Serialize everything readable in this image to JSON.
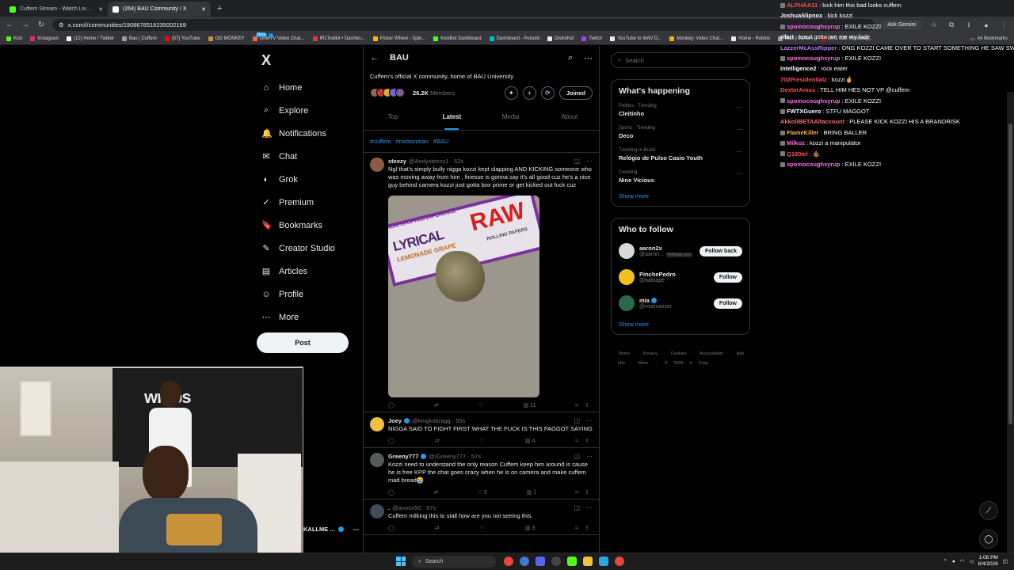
{
  "browser": {
    "tabs": [
      {
        "title": "Cuffem Stream - Watch Live on",
        "favicon_color": "#53fc18",
        "active": false
      },
      {
        "title": "(264) BAU Community / X",
        "favicon_color": "#ffffff",
        "active": true
      }
    ],
    "new_tab": "+",
    "url": "x.com/i/communities/1908678516235002169",
    "ask_gemini": "Ask Gemini",
    "bookmarks": [
      {
        "label": "Kick",
        "color": "#53fc18"
      },
      {
        "label": "Instagram",
        "color": "#e1306c"
      },
      {
        "label": "(12) Home / Twitter",
        "color": "#ffffff"
      },
      {
        "label": "Bau | Cuffem",
        "color": "#9aa0a6"
      },
      {
        "label": "(57) YouTube",
        "color": "#ff0000"
      },
      {
        "label": "OG MONKEY",
        "color": "#c58f3d"
      },
      {
        "label": "OmeTV Video Chat...",
        "color": "#f26b3a"
      },
      {
        "label": "IRLToolkit • Dashbo...",
        "color": "#e53935"
      },
      {
        "label": "Picker Wheel - Spin...",
        "color": "#fbbc05"
      },
      {
        "label": "KickBot Dashboard",
        "color": "#53fc18"
      },
      {
        "label": "Dashboard - Pulsoid",
        "color": "#00bcd4"
      },
      {
        "label": "DistroKid",
        "color": "#e8eaed"
      },
      {
        "label": "Twitch",
        "color": "#9146ff"
      },
      {
        "label": "YouTube to WAV D...",
        "color": "#e8eaed"
      },
      {
        "label": "Monkey: Video Chat...",
        "color": "#f5b400"
      },
      {
        "label": "Home - Roblox",
        "color": "#e8eaed"
      },
      {
        "label": "Bau | Cuffem",
        "color": "#9aa0a6"
      },
      {
        "label": "UFC 328: Holloway...",
        "color": "#d20a0a"
      }
    ],
    "all_bookmarks": "All Bookmarks"
  },
  "nav": {
    "logo": "X",
    "items": [
      {
        "label": "Home",
        "icon": "⌂"
      },
      {
        "label": "Explore",
        "icon": "⌕"
      },
      {
        "label": "Notifications",
        "icon": "🔔"
      },
      {
        "label": "Chat",
        "icon": "✉"
      },
      {
        "label": "Grok",
        "icon": "◐"
      },
      {
        "label": "Premium",
        "icon": "✓"
      },
      {
        "label": "Bookmarks",
        "icon": "🔖"
      },
      {
        "label": "Creator Studio",
        "icon": "✎"
      },
      {
        "label": "Articles",
        "icon": "▤"
      },
      {
        "label": "Profile",
        "icon": "☺"
      },
      {
        "label": "More",
        "icon": "⋯"
      }
    ],
    "chat_badge": "Beta",
    "post_button": "Post"
  },
  "community": {
    "back": "←",
    "title": "BAU",
    "description": "Cuffem's official X community, home of BAU University",
    "members_count": "26.2K",
    "members_label": "Members",
    "joined": "Joined",
    "tabs": [
      "Top",
      "Latest",
      "Media",
      "About"
    ],
    "active_tab": "Latest",
    "hashtags": [
      "#cuffem",
      "#motionman",
      "#BAU"
    ]
  },
  "posts": [
    {
      "name": "steezy",
      "handle": "@Andysteezy1 · 52s",
      "verified": false,
      "avatar_color": "#8a5a44",
      "text": "Ngl that's simply bully nigga kozzi kept slapping AND KICKING someone who was moving away from him , finesse is gonna say it's all good cuz he's a nice guy behind camera kozzi just gotta box prime or get kicked out fuck cuz",
      "views": "11",
      "has_image": true,
      "image": {
        "pack_top": "REAL UPLIFTING EXPERIENCE",
        "pack_brand": "LYRICAL",
        "pack_raw": "RAW",
        "pack_flavor": "LEMONADE GRAPE",
        "pack_sub": "ROLLING PAPERS"
      }
    },
    {
      "name": "Joey",
      "handle": "@kingkobragg · 55s",
      "verified": true,
      "avatar_color": "#f0c040",
      "text": "NIGGA SAID TO FIGHT FIRST WHAT THE FUCK IS THIS FAGGOT SAYING",
      "views": "4",
      "has_image": false
    },
    {
      "name": "Greeny777",
      "handle": "@IGreeny777 · 57s",
      "verified": true,
      "avatar_color": "#555b55",
      "text": "Kozzi need to understand the only reason Cuffem keep him around is cause he is free KPP the chat goes crazy when he is on camera and make cuffem mad bread😭",
      "likes": "5",
      "views": "1",
      "has_image": false
    },
    {
      "name": ".",
      "handle": "@anonx50 · 57s",
      "verified": false,
      "avatar_color": "#444a5a",
      "text": "Cuffem milking this to stall how are you not seeing this.",
      "views": "3",
      "has_image": false
    }
  ],
  "right": {
    "search_placeholder": "Search",
    "happening_title": "What's happening",
    "trends": [
      {
        "meta": "Politics · Trending",
        "name": "Cleitinho"
      },
      {
        "meta": "Sports · Trending",
        "name": "Deco"
      },
      {
        "meta": "Trending in Brazil",
        "name": "Relógio de Pulso Casio Youth"
      },
      {
        "meta": "Trending",
        "name": "Nine Vicious"
      }
    ],
    "show_more": "Show more",
    "wtf_title": "Who to follow",
    "follow": [
      {
        "name": "aaron2x",
        "handle": "@aaron...",
        "follows_you": "Follows you",
        "button": "Follow back",
        "color": "#d9d9d9",
        "verified": false
      },
      {
        "name": "PinchePedro",
        "handle": "@babiape",
        "follows_you": "",
        "button": "Follow",
        "color": "#f0c020",
        "verified": false
      },
      {
        "name": "mia",
        "handle": "@miamaxxer",
        "follows_you": "",
        "button": "Follow",
        "color": "#2a6a4a",
        "verified": true
      }
    ],
    "footer": "Terms · Privacy · Cookies · Accessibility · Ads info · More ··· © 2026 X Corp."
  },
  "chat_overlay": [
    {
      "user": "ALPHAA11",
      "text": "kick him this bad looks cuffem",
      "color": "#ff4d4d",
      "badge": true
    },
    {
      "user": "JoshuaSlipnox",
      "text": "kick kozzi",
      "color": "#ffffff",
      "badge": false
    },
    {
      "user": "spomocoughsyrup",
      "text": "EXILE KOZZI",
      "color": "#ff6be6",
      "badge": true
    },
    {
      "user": "rifart",
      "text": "kozzi gotta run me my fade",
      "color": "#ffffff",
      "badge": false
    },
    {
      "user": "LazzerMcAssRipper",
      "text": "ONG KOZZI CAME OVER TO START SOMETHING HE SAW SWEATER PUNK HIM",
      "color": "#c07cff",
      "badge": false
    },
    {
      "user": "spomocoughsyrup",
      "text": "EXILE KOZZI",
      "color": "#ff6be6",
      "badge": true
    },
    {
      "user": "Intelligence2",
      "text": "rock eater",
      "color": "#ffffff",
      "badge": false
    },
    {
      "user": "702Presidentlalz",
      "text": "kozzi🤞",
      "color": "#ff4d6d",
      "badge": false
    },
    {
      "user": "DexterAmos",
      "text": "TELL HIM HES NOT VP @cuffem",
      "color": "#ff4d4d",
      "badge": false
    },
    {
      "user": "spomocoughsyrup",
      "text": "EXILE KOZZI",
      "color": "#ff6be6",
      "badge": true
    },
    {
      "user": "FWTXGuero",
      "text": "STFU MAGGOT",
      "color": "#ffffff",
      "badge": true
    },
    {
      "user": "AkkoliBETAAltaccount",
      "text": "PLEASE KICK KOZZI HIS A BRANDRISK",
      "color": "#ff6b6b",
      "badge": false
    },
    {
      "user": "FlameKiller",
      "text": "BRING BALLER",
      "color": "#ffb347",
      "badge": true
    },
    {
      "user": "Milkoz",
      "text": "kozzi a manipulator",
      "color": "#ff6be6",
      "badge": true
    },
    {
      "user": "Q180lel",
      "text": "🤹",
      "color": "#ff4d4d",
      "badge": true
    },
    {
      "user": "spomocoughsyrup",
      "text": "EXILE KOZZI",
      "color": "#ff6be6",
      "badge": true
    }
  ],
  "webcam": {
    "banner_text": "wraps"
  },
  "streamer_name": "KALLME ...",
  "taskbar": {
    "search": "Search",
    "time": "1:08 PM",
    "date": "8/4/2026"
  }
}
